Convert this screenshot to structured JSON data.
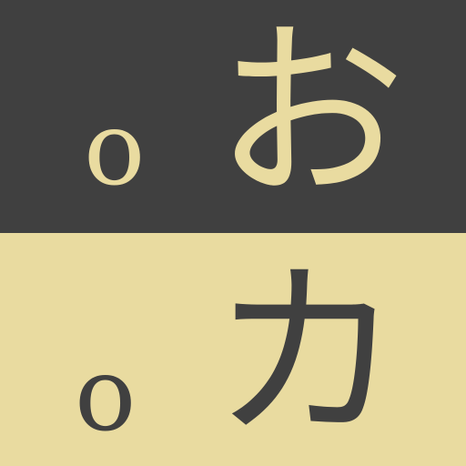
{
  "top_panel": {
    "romaji": "o",
    "kana": "お",
    "background_color": "#404040",
    "text_color": "#e9dba0"
  },
  "bottom_panel": {
    "romaji": "o",
    "kana": "カ",
    "background_color": "#e9dba0",
    "text_color": "#404040"
  }
}
